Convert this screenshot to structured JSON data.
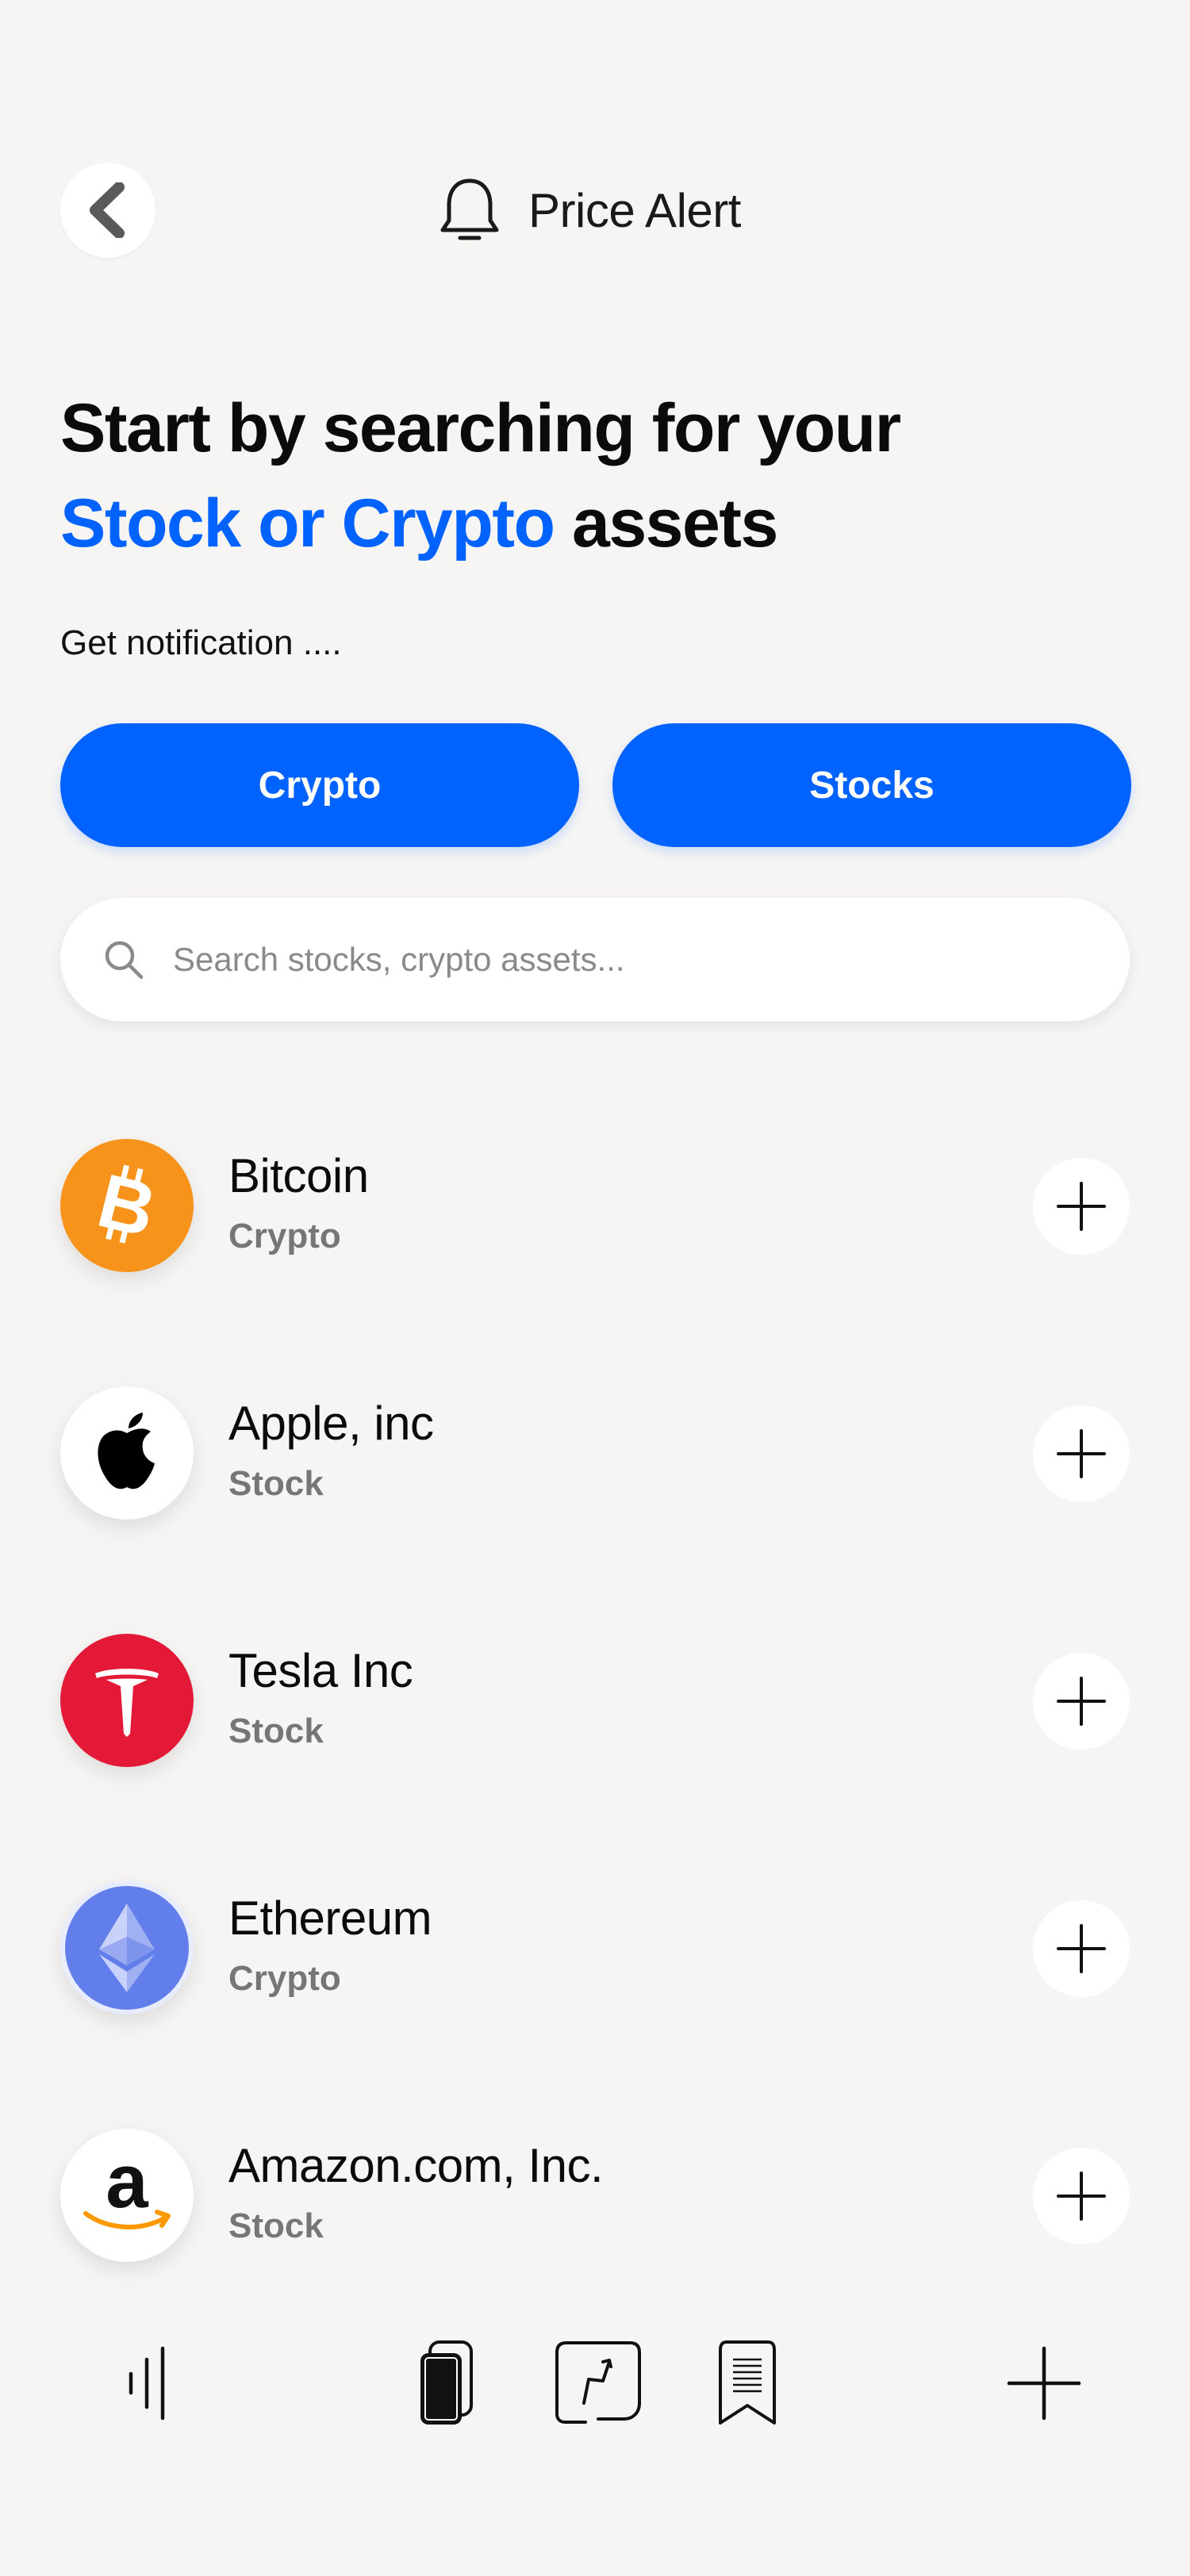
{
  "header": {
    "title": "Price Alert",
    "back_icon": "chevron-left-icon",
    "title_icon": "bell-icon"
  },
  "headline": {
    "line1": "Start by searching for your",
    "highlight": "Stock or Crypto",
    "rest": " assets"
  },
  "subtext": "Get notification ....",
  "tabs": [
    {
      "label": "Crypto"
    },
    {
      "label": "Stocks"
    }
  ],
  "search": {
    "placeholder": "Search stocks, crypto assets...",
    "value": ""
  },
  "assets": [
    {
      "name": "Bitcoin",
      "type": "Crypto",
      "icon": "bitcoin-icon"
    },
    {
      "name": "Apple, inc",
      "type": "Stock",
      "icon": "apple-icon"
    },
    {
      "name": "Tesla Inc",
      "type": "Stock",
      "icon": "tesla-icon"
    },
    {
      "name": "Ethereum",
      "type": "Crypto",
      "icon": "ethereum-icon"
    },
    {
      "name": "Amazon.com, Inc.",
      "type": "Stock",
      "icon": "amazon-icon"
    }
  ],
  "colors": {
    "accent": "#0062ff",
    "background": "#f6f5f4",
    "bitcoin": "#f7931a",
    "tesla": "#e31937",
    "ethereum": "#627eea",
    "amazon_arrow": "#ff9900"
  },
  "bottom_nav": [
    {
      "icon": "menu-bars-icon"
    },
    {
      "icon": "phone-icon"
    },
    {
      "icon": "chart-icon"
    },
    {
      "icon": "receipt-icon"
    },
    {
      "icon": "plus-icon"
    }
  ]
}
